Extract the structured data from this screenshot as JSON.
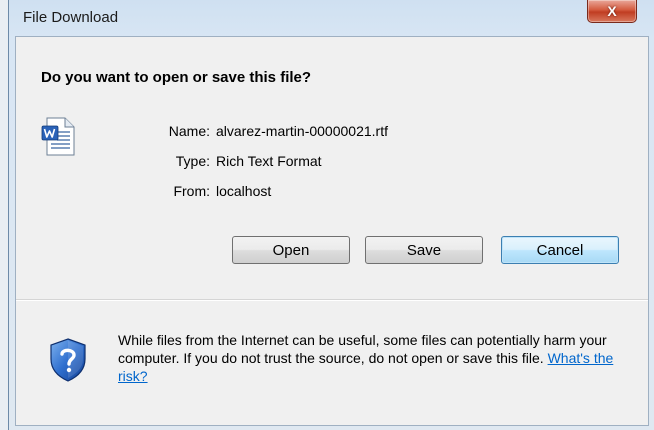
{
  "window": {
    "title": "File Download",
    "close_label": "X"
  },
  "dialog": {
    "question": "Do you want to open or save this file?",
    "file": {
      "name_label": "Name:",
      "name_value": "alvarez-martin-00000021.rtf",
      "type_label": "Type:",
      "type_value": "Rich Text Format",
      "from_label": "From:",
      "from_value": "localhost"
    },
    "buttons": {
      "open": "Open",
      "save": "Save",
      "cancel": "Cancel"
    },
    "warning": {
      "text": "While files from the Internet can be useful, some files can potentially harm your computer. If you do not trust the source, do not open or save this file.",
      "link": "What's the risk?"
    }
  },
  "icons": {
    "file": "word-document-icon",
    "security": "shield-question-icon"
  },
  "colors": {
    "link": "#0066cc",
    "default_button_border": "#3c7fb1",
    "close_button": "#c03d22"
  }
}
